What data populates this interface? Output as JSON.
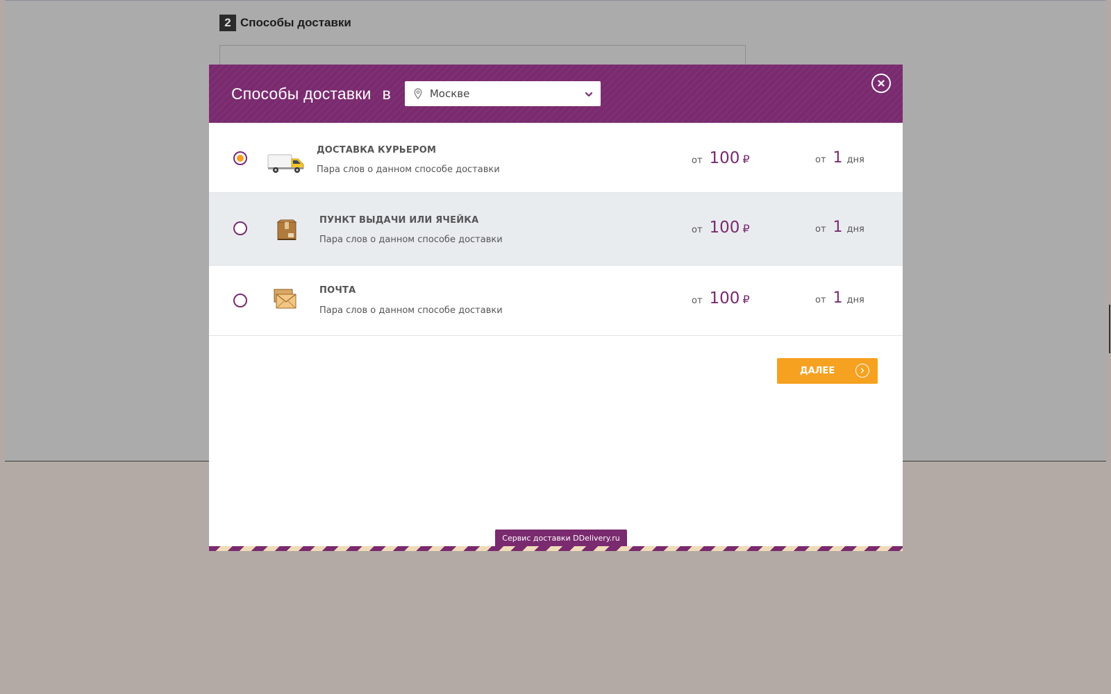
{
  "background": {
    "step_number": "2",
    "step_title": "Способы доставки"
  },
  "modal": {
    "title": "Способы доставки",
    "title_prep": "в",
    "city": "Москве",
    "icons": {
      "city": "map-pin-icon",
      "dropdown": "chevron-down-icon",
      "close": "close-icon",
      "next": "chevron-right-circle-icon"
    },
    "options": [
      {
        "name": "ДОСТАВКА КУРЬЕРОМ",
        "desc": "Пара слов о данном способе доставки",
        "price_from": "от",
        "price": "100",
        "currency": "₽",
        "term_from": "от",
        "term": "1",
        "term_unit": "дня",
        "selected": true,
        "icon": "truck-icon"
      },
      {
        "name": "ПУНКТ ВЫДАЧИ ИЛИ ЯЧЕЙКА",
        "desc": "Пара слов о данном способе доставки",
        "price_from": "от",
        "price": "100",
        "currency": "₽",
        "term_from": "от",
        "term": "1",
        "term_unit": "дня",
        "selected": false,
        "icon": "parcel-box-icon"
      },
      {
        "name": "ПОЧТА",
        "desc": "Пара слов о данном способе доставки",
        "price_from": "от",
        "price": "100",
        "currency": "₽",
        "term_from": "от",
        "term": "1",
        "term_unit": "дня",
        "selected": false,
        "icon": "envelope-icon"
      }
    ],
    "next_label": "ДАЛЕЕ",
    "footer": "Сервис доставки DDelivery.ru"
  },
  "colors": {
    "brand_purple": "#7a2a6f",
    "accent_orange": "#f7a120",
    "overlay": "#b3aaa5"
  }
}
